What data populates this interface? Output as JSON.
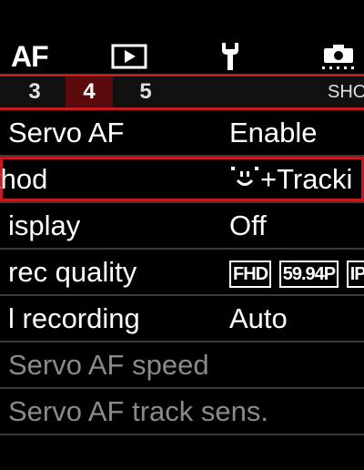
{
  "tabs_top": {
    "af_label": "AF",
    "play_icon": "play-icon",
    "wrench_icon": "wrench-icon",
    "camera_icon": "camera-icon"
  },
  "page_tabs": {
    "tab_3": "3",
    "tab_4": "4",
    "tab_5": "5",
    "sho": "SHO"
  },
  "menu": {
    "items": [
      {
        "label": "Servo AF",
        "value": "Enable"
      },
      {
        "label": "thod",
        "value": "+Tracki"
      },
      {
        "label": "isplay",
        "value": "Off"
      },
      {
        "label": "rec quality",
        "value": ""
      },
      {
        "label": "l recording",
        "value": "Auto"
      },
      {
        "label": "Servo AF speed",
        "value": ""
      },
      {
        "label": "Servo AF track sens.",
        "value": ""
      }
    ],
    "quality_badges": [
      "FHD",
      "59.94P",
      "IP"
    ]
  },
  "colors": {
    "accent": "#c31a21",
    "selected_tab": "#5a0a0d",
    "dim_text": "#8a8a8a"
  }
}
